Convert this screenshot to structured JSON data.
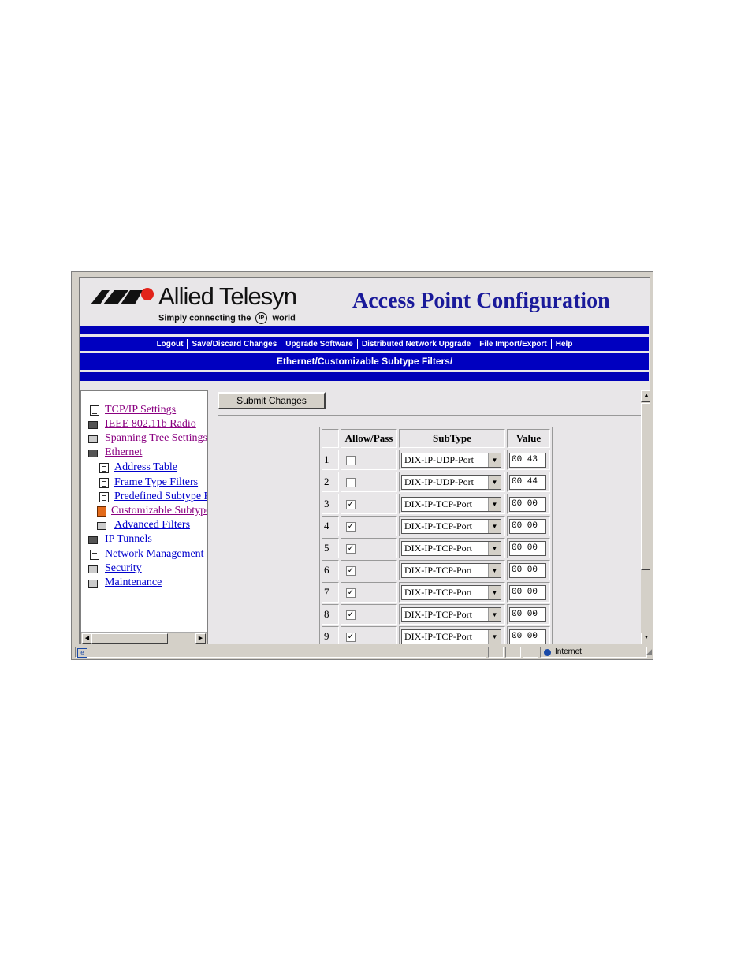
{
  "logo": {
    "company": "Allied Telesyn",
    "tagline_pre": "Simply connecting the",
    "tagline_ip": "IP",
    "tagline_post": "world"
  },
  "header": {
    "title": "Access Point Configuration"
  },
  "nav": [
    {
      "label": "Logout"
    },
    {
      "label": "Save/Discard Changes"
    },
    {
      "label": "Upgrade Software"
    },
    {
      "label": "Distributed Network Upgrade"
    },
    {
      "label": "File Import/Export"
    },
    {
      "label": "Help"
    }
  ],
  "breadcrumb": "Ethernet/Customizable Subtype Filters/",
  "sidebar": {
    "items": [
      {
        "label": "TCP/IP Settings",
        "icon": "document-icon"
      },
      {
        "label": "IEEE 802.11b Radio",
        "icon": "folder-icon"
      },
      {
        "label": "Spanning Tree Settings",
        "icon": "folder-icon"
      },
      {
        "label": "Ethernet",
        "icon": "folder-open-icon"
      },
      {
        "label": "Address Table",
        "icon": "document-icon"
      },
      {
        "label": "Frame Type Filters",
        "icon": "document-icon"
      },
      {
        "label": "Predefined Subtype Filters",
        "icon": "document-icon"
      },
      {
        "label": "Customizable Subtype Filters",
        "icon": "document-active-icon"
      },
      {
        "label": "Advanced Filters",
        "icon": "folder-icon"
      },
      {
        "label": "IP Tunnels",
        "icon": "folder-icon"
      },
      {
        "label": "Network Management",
        "icon": "document-icon"
      },
      {
        "label": "Security",
        "icon": "folder-icon"
      },
      {
        "label": "Maintenance",
        "icon": "folder-icon"
      }
    ]
  },
  "form": {
    "submit_label": "Submit Changes"
  },
  "table": {
    "headers": [
      "",
      "Allow/Pass",
      "SubType",
      "Value"
    ],
    "rows": [
      {
        "num": "1",
        "checked": false,
        "subtype": "DIX-IP-UDP-Port",
        "value": "00 43"
      },
      {
        "num": "2",
        "checked": false,
        "subtype": "DIX-IP-UDP-Port",
        "value": "00 44"
      },
      {
        "num": "3",
        "checked": true,
        "subtype": "DIX-IP-TCP-Port",
        "value": "00 00"
      },
      {
        "num": "4",
        "checked": true,
        "subtype": "DIX-IP-TCP-Port",
        "value": "00 00"
      },
      {
        "num": "5",
        "checked": true,
        "subtype": "DIX-IP-TCP-Port",
        "value": "00 00"
      },
      {
        "num": "6",
        "checked": true,
        "subtype": "DIX-IP-TCP-Port",
        "value": "00 00"
      },
      {
        "num": "7",
        "checked": true,
        "subtype": "DIX-IP-TCP-Port",
        "value": "00 00"
      },
      {
        "num": "8",
        "checked": true,
        "subtype": "DIX-IP-TCP-Port",
        "value": "00 00"
      },
      {
        "num": "9",
        "checked": true,
        "subtype": "DIX-IP-TCP-Port",
        "value": "00 00"
      }
    ]
  },
  "statusbar": {
    "zone": "Internet"
  }
}
